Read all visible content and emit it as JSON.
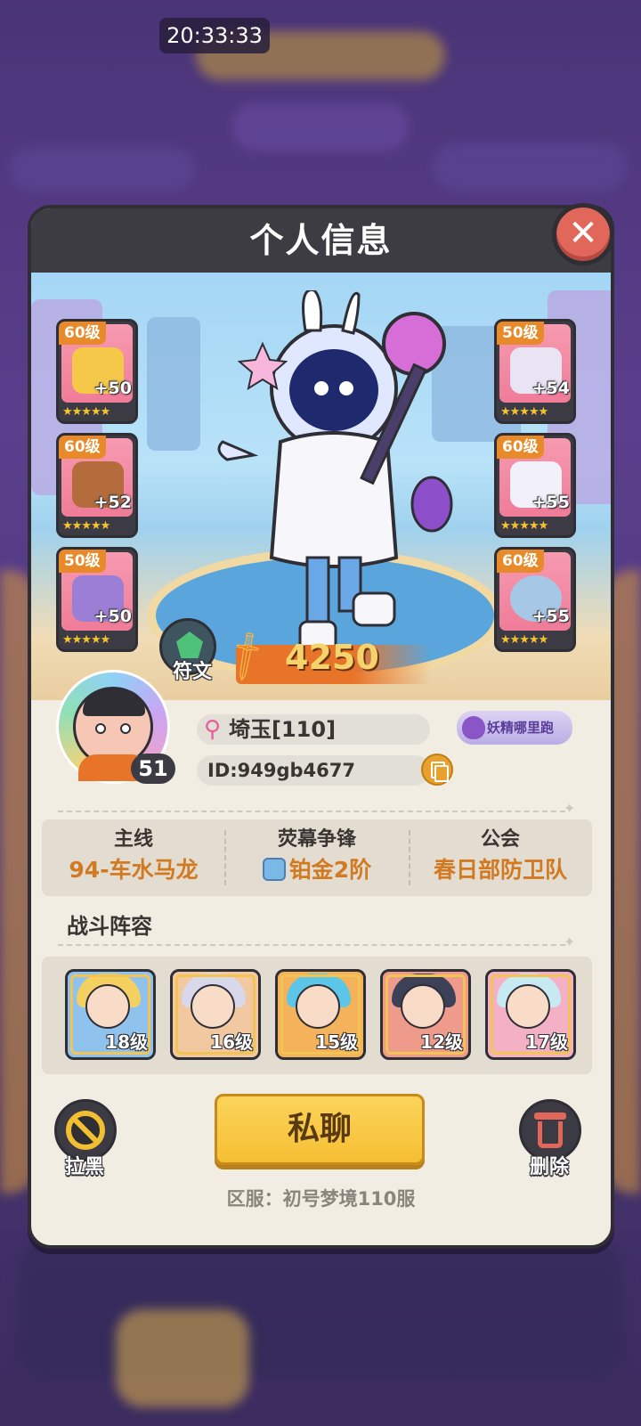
{
  "status_bar": {
    "time": "20:33:33"
  },
  "dialog": {
    "title": "个人信息",
    "close_icon": "close-icon"
  },
  "equipment": {
    "left": [
      {
        "level": "60级",
        "plus": "+50",
        "stars": "★★★★★",
        "color": "#f5c84a"
      },
      {
        "level": "60级",
        "plus": "+52",
        "stars": "★★★★★",
        "color": "#b46c3d"
      },
      {
        "level": "50级",
        "plus": "+50",
        "stars": "★★★★★",
        "color": "#9b7fd6"
      }
    ],
    "right": [
      {
        "level": "50级",
        "plus": "+54",
        "stars": "★★★★★",
        "color": "#e9e4f4"
      },
      {
        "level": "60级",
        "plus": "+55",
        "stars": "★★★★★",
        "color": "#f2f0f8"
      },
      {
        "level": "60级",
        "plus": "+55",
        "stars": "★★★★★",
        "color": "#a7c7e6"
      }
    ]
  },
  "rune": {
    "label": "符文"
  },
  "combat_power": {
    "value": "4250"
  },
  "profile": {
    "level": "51",
    "name": "埼玉[110]",
    "id": "ID:949gb4677",
    "team_badge": "妖精哪里跑"
  },
  "stats": [
    {
      "label": "主线",
      "value": "94-车水马龙"
    },
    {
      "label": "荧幕争锋",
      "value": "铂金2阶"
    },
    {
      "label": "公会",
      "value": "春日部防卫队"
    }
  ],
  "lineup": {
    "title": "战斗阵容",
    "heroes": [
      {
        "level": "18级",
        "bg": "#8fc3ee",
        "hair": "#f4d060"
      },
      {
        "level": "16级",
        "bg": "#f2c8a0",
        "hair": "#d9d7ea"
      },
      {
        "level": "15级",
        "bg": "#f4b35b",
        "hair": "#5bc6e8"
      },
      {
        "level": "12级",
        "bg": "#ee9b8c",
        "hair": "#3c4158"
      },
      {
        "level": "17级",
        "bg": "#f4b0c4",
        "hair": "#c6e9f2"
      }
    ]
  },
  "actions": {
    "block_label": "拉黑",
    "chat_label": "私聊",
    "delete_label": "删除"
  },
  "server": "区服：初号梦境110服"
}
